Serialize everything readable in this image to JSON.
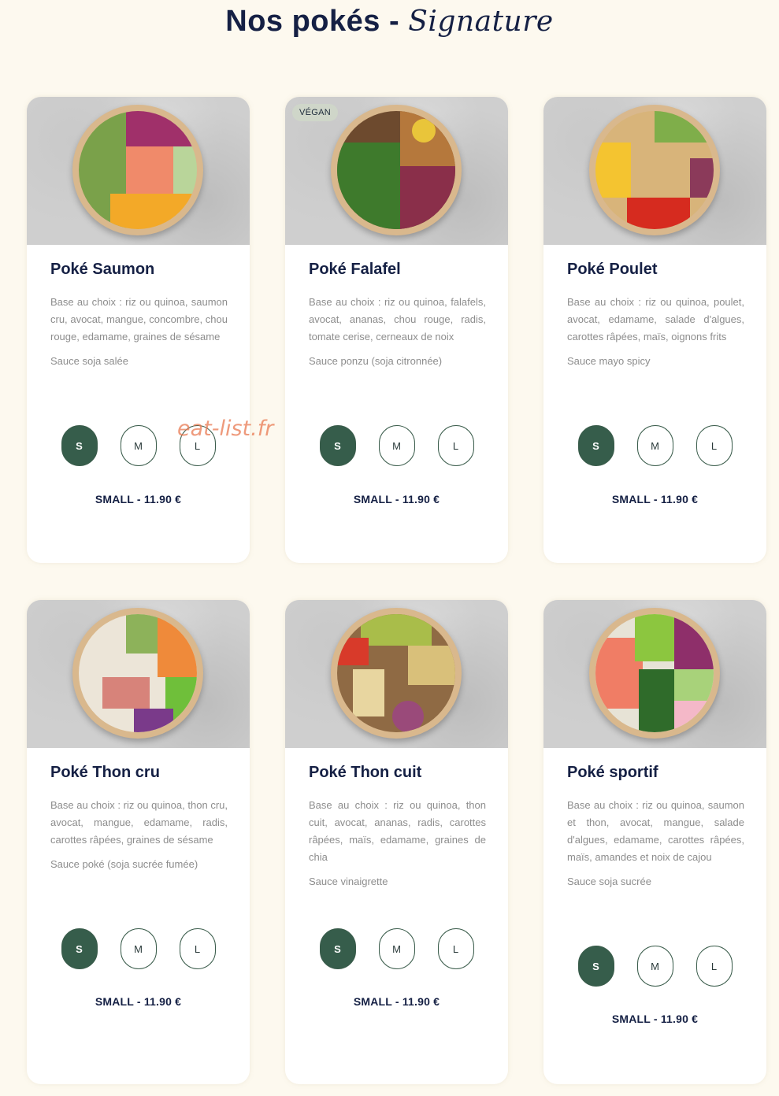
{
  "page": {
    "title_main": "Nos pokés -",
    "title_script": "Signature"
  },
  "watermark": "eat-list.fr",
  "colors": {
    "accent_green": "#365d4b",
    "background": "#fdf9ef",
    "title_navy": "#152044",
    "text_grey": "#8d8d8d"
  },
  "sizes": [
    "S",
    "M",
    "L"
  ],
  "cards": [
    {
      "title": "Poké Saumon",
      "badge": "",
      "description": "Base au choix : riz ou quinoa, saumon cru, avocat, mangue, concombre, chou rouge, edamame, graines de sésame",
      "sauce": "Sauce soja salée",
      "selected_size": "S",
      "price": "SMALL - 11.90 €"
    },
    {
      "title": "Poké Falafel",
      "badge": "VÉGAN",
      "description": "Base au choix : riz ou quinoa, falafels, avocat, ananas, chou rouge, radis, tomate cerise, cerneaux de noix",
      "sauce": "Sauce ponzu (soja citronnée)",
      "selected_size": "S",
      "price": "SMALL - 11.90 €"
    },
    {
      "title": "Poké Poulet",
      "badge": "",
      "description": "Base au choix : riz ou quinoa, poulet, avocat, edamame, salade d'algues, carottes râpées, maïs, oignons frits",
      "sauce": "Sauce mayo spicy",
      "selected_size": "S",
      "price": "SMALL - 11.90 €"
    },
    {
      "title": "Poké Thon cru",
      "badge": "",
      "description": "Base au choix : riz ou quinoa, thon cru, avocat, mangue, edamame, radis, carottes râpées, graines de sésame",
      "sauce": "Sauce poké (soja sucrée fumée)",
      "selected_size": "S",
      "price": "SMALL - 11.90 €"
    },
    {
      "title": "Poké Thon cuit",
      "badge": "",
      "description": "Base au choix : riz ou quinoa, thon cuit, avocat, ananas, radis, carottes râpées, maïs, edamame, graines de chia",
      "sauce": "Sauce vinaigrette",
      "selected_size": "S",
      "price": "SMALL - 11.90 €"
    },
    {
      "title": "Poké sportif",
      "badge": "",
      "description": "Base au choix : riz ou quinoa, saumon et thon, avocat, mangue, salade d'algues, edamame, carottes râpées, maïs, amandes et noix de cajou",
      "sauce": "Sauce soja sucrée",
      "selected_size": "S",
      "price": "SMALL - 11.90 €"
    }
  ]
}
